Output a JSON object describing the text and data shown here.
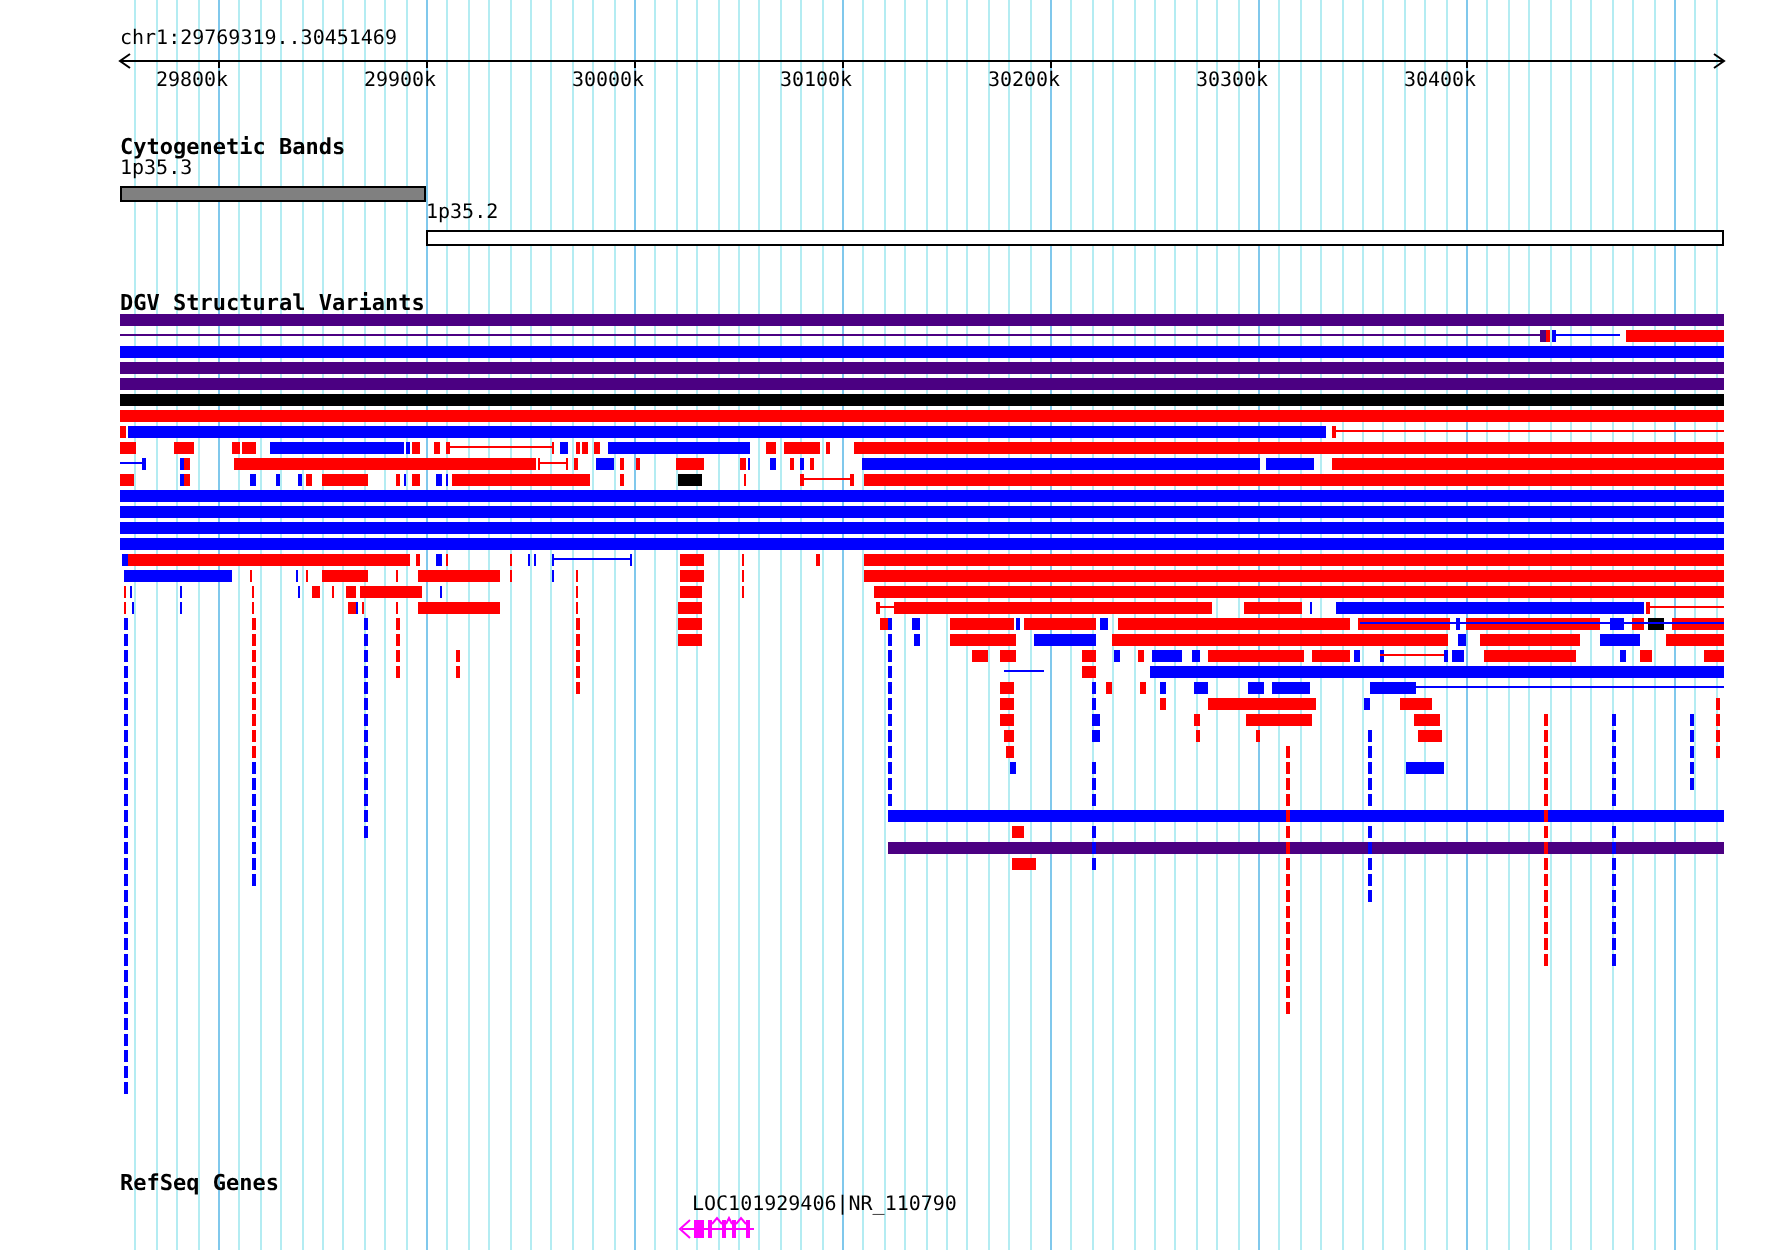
{
  "locus": "chr1:29769319..30451469",
  "ruler": {
    "ticks": [
      "29800k",
      "29900k",
      "30000k",
      "30100k",
      "30200k",
      "30300k",
      "30400k"
    ]
  },
  "tracks": [
    {
      "kind": "cytoband",
      "title": "Cytogenetic Bands",
      "bands": [
        {
          "label": "1p35.3",
          "color": "#808080"
        },
        {
          "label": "1p35.2",
          "color": "#ffffff"
        }
      ]
    },
    {
      "kind": "variants",
      "title": "DGV Structural Variants"
    },
    {
      "kind": "genes",
      "title": "RefSeq Genes",
      "genes": [
        {
          "label": "LOC101929406|NR_110790",
          "reverse_strand": true
        }
      ]
    }
  ]
}
